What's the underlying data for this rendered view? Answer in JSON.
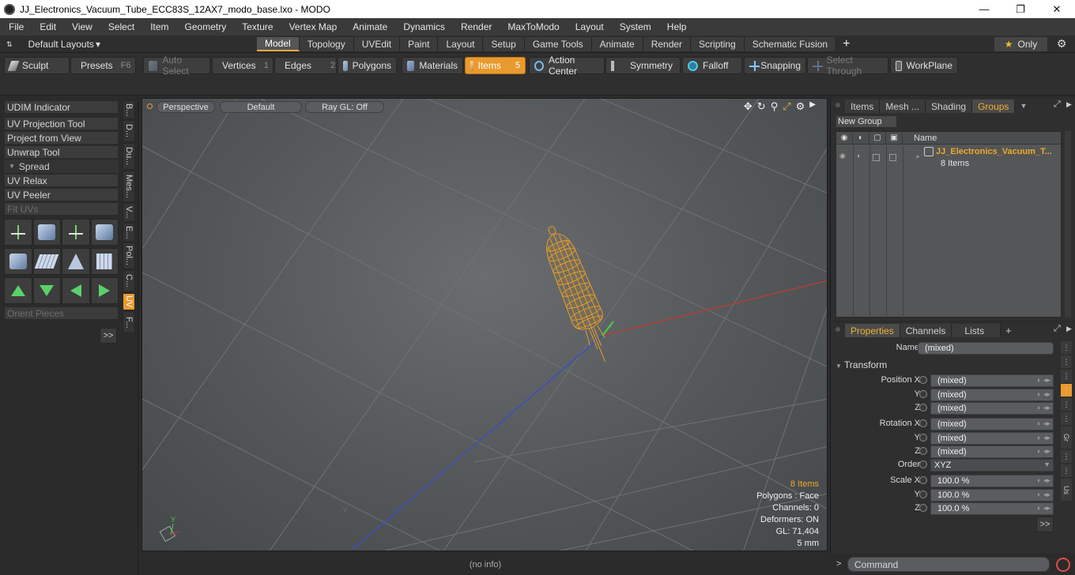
{
  "window": {
    "title": "JJ_Electronics_Vacuum_Tube_ECC83S_12AX7_modo_base.lxo - MODO",
    "minimize": "—",
    "maximize": "❐",
    "close": "✕"
  },
  "menu": [
    "File",
    "Edit",
    "View",
    "Select",
    "Item",
    "Geometry",
    "Texture",
    "Vertex Map",
    "Animate",
    "Dynamics",
    "Render",
    "MaxToModo",
    "Layout",
    "System",
    "Help"
  ],
  "layouts": {
    "label": "Default Layouts",
    "caret": "▾"
  },
  "tabs": [
    "Model",
    "Topology",
    "UVEdit",
    "Paint",
    "Layout",
    "Setup",
    "Game Tools",
    "Animate",
    "Render",
    "Scripting",
    "Schematic Fusion"
  ],
  "tab_add": "+",
  "only": {
    "star": "★",
    "label": "Only"
  },
  "toolbar": {
    "sculpt": "Sculpt",
    "presets": "Presets",
    "presets_key": "F6",
    "auto_select": "Auto Select",
    "vertices": "Vertices",
    "vertices_key": "1",
    "edges": "Edges",
    "edges_key": "2",
    "polygons": "Polygons",
    "materials": "Materials",
    "items": "Items",
    "items_key": "5",
    "action_center": "Action Center",
    "symmetry": "Symmetry",
    "falloff": "Falloff",
    "snapping": "Snapping",
    "select_through": "Select Through",
    "workplane": "WorkPlane"
  },
  "left_panel": {
    "udim": "UDIM Indicator",
    "uv_projection": "UV Projection Tool",
    "project_from_view": "Project from View",
    "unwrap": "Unwrap Tool",
    "spread": "Spread",
    "uv_relax": "UV Relax",
    "uv_peeler": "UV Peeler",
    "fit_uvs": "Fit UVs",
    "orient_pieces": "Orient Pieces",
    "more": ">>",
    "vtabs": [
      "B...",
      "D...",
      "Du...",
      "Mes...",
      "V...",
      "E...",
      "Pol...",
      "C...",
      "UV",
      "F..."
    ]
  },
  "viewport": {
    "perspective": "Perspective",
    "default": "Default",
    "raygl": "Ray GL: Off",
    "info_items": "8 Items",
    "info_polygons": "Polygons : Face",
    "info_channels": "Channels: 0",
    "info_deformers": "Deformers: ON",
    "info_gl": "GL: 71,404",
    "info_scale": "5 mm",
    "axis_y": "-Y",
    "axis_gizmo_y": "Y"
  },
  "status": {
    "text": "(no info)"
  },
  "items_panel": {
    "tabs": [
      "Items",
      "Mesh ...",
      "Shading",
      "Groups"
    ],
    "new_group": "New Group",
    "col_name": "Name",
    "group_name": "JJ_Electronics_Vacuum_T...",
    "group_count": "8 Items"
  },
  "properties": {
    "tabs": [
      "Properties",
      "Channels",
      "Lists"
    ],
    "add": "+",
    "name_label": "Name",
    "name_value": "(mixed)",
    "transform": "Transform",
    "rows": [
      {
        "label": "Position X",
        "value": "(mixed)"
      },
      {
        "label": "Y",
        "value": "(mixed)"
      },
      {
        "label": "Z",
        "value": "(mixed)"
      },
      {
        "label": "Rotation X",
        "value": "(mixed)"
      },
      {
        "label": "Y",
        "value": "(mixed)"
      },
      {
        "label": "Z",
        "value": "(mixed)"
      },
      {
        "label": "Order",
        "value": "XYZ"
      },
      {
        "label": "Scale X",
        "value": "100.0 %"
      },
      {
        "label": "Y",
        "value": "100.0 %"
      },
      {
        "label": "Z",
        "value": "100.0 %"
      }
    ],
    "more": ">>",
    "side_labels": [
      "Gr",
      "Us"
    ]
  },
  "command": {
    "prompt": ">",
    "placeholder": "Command"
  },
  "colors": {
    "accent": "#e99a2f",
    "selection": "#f0a828"
  }
}
